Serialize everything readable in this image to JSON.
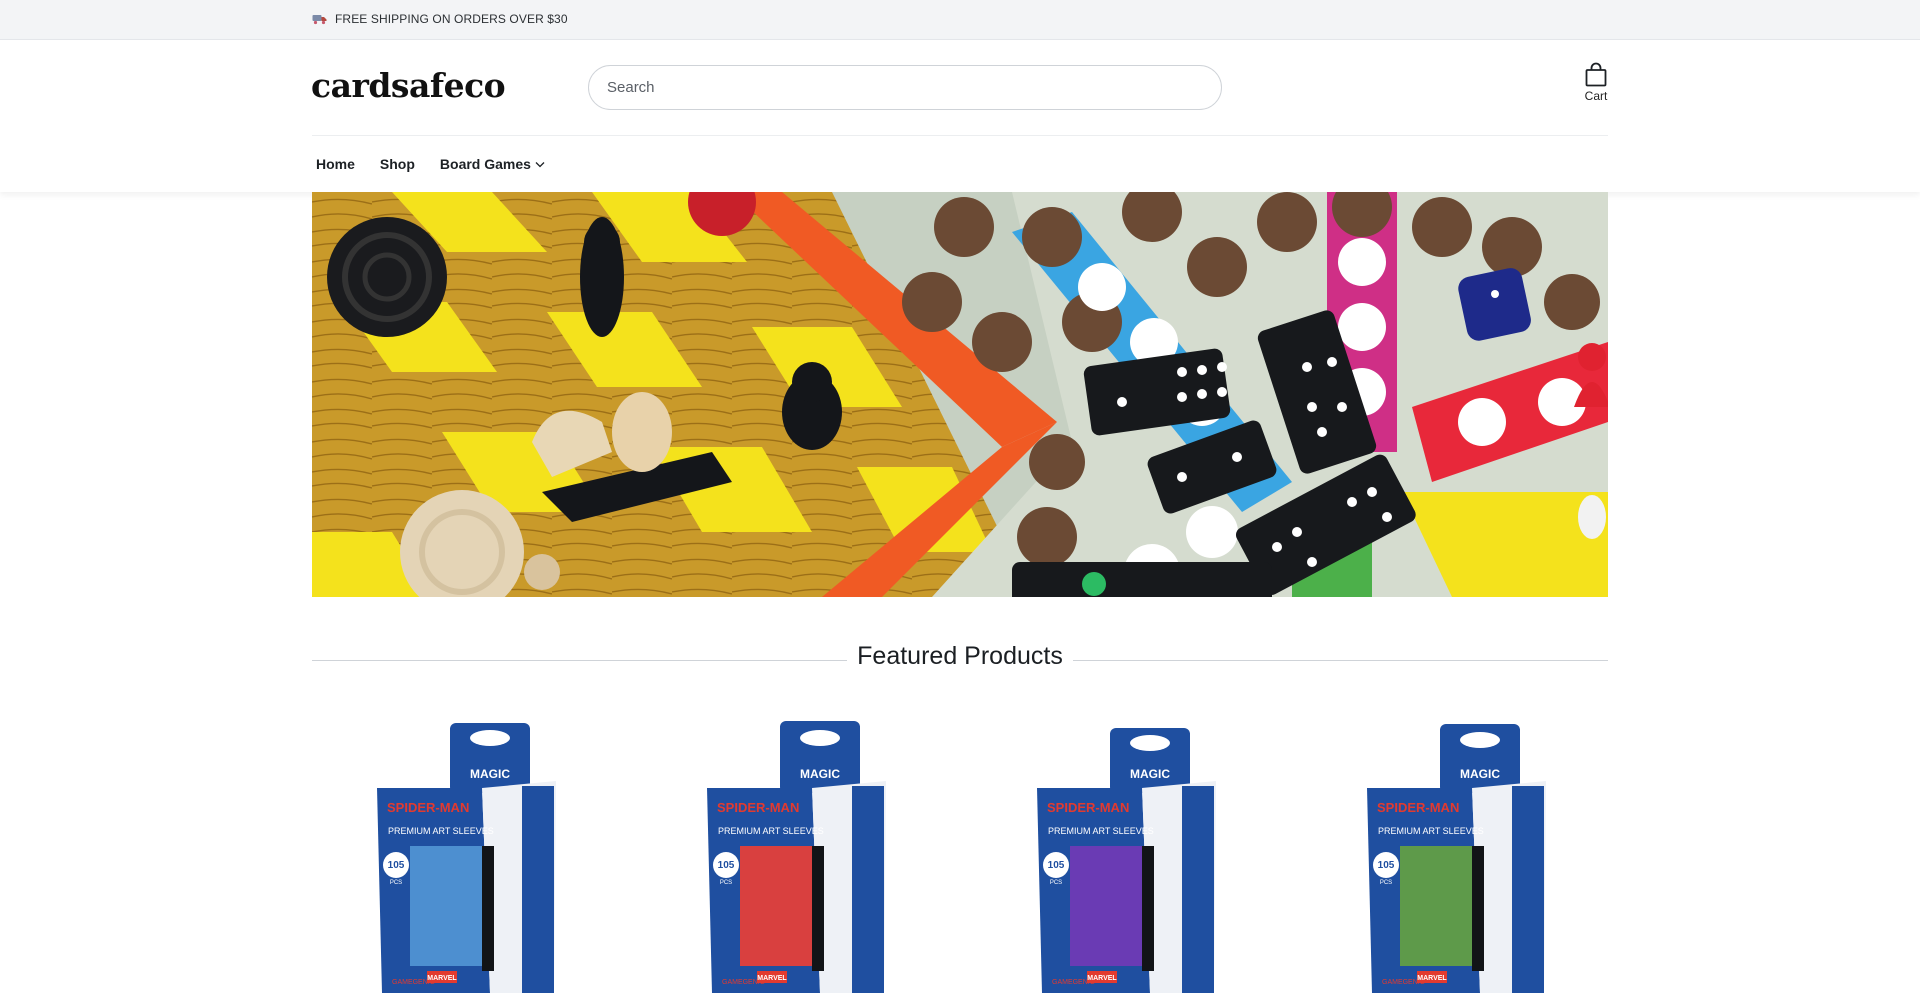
{
  "announcement": {
    "icon": "truck-icon",
    "text": "FREE SHIPPING ON ORDERS OVER $30"
  },
  "header": {
    "logo": "cardsafeco",
    "search_placeholder": "Search",
    "cart_label": "Cart",
    "cart_icon": "shopping-bag-icon"
  },
  "nav": {
    "items": [
      {
        "label": "Home"
      },
      {
        "label": "Shop"
      },
      {
        "label": "Board Games",
        "icon": "chevron-down-icon"
      }
    ]
  },
  "hero": {
    "description": "board-games-banner"
  },
  "featured": {
    "title": "Featured Products",
    "products": [
      {
        "brand": "SPIDER-MAN",
        "sub_brand": "MAGIC",
        "line": "PREMIUM ART SLEEVES",
        "count": "105",
        "count_unit": "PCS",
        "maker": "GAMEGENIC",
        "label": "MARVEL",
        "accent": "#4d8fd0"
      },
      {
        "brand": "SPIDER-MAN",
        "sub_brand": "MAGIC",
        "line": "PREMIUM ART SLEEVES",
        "count": "105",
        "count_unit": "PCS",
        "maker": "GAMEGENIC",
        "label": "MARVEL",
        "accent": "#d9403f"
      },
      {
        "brand": "SPIDER-MAN",
        "sub_brand": "MAGIC",
        "line": "PREMIUM ART SLEEVES",
        "count": "105",
        "count_unit": "PCS",
        "maker": "GAMEGENIC",
        "label": "MARVEL",
        "accent": "#6a3bb4"
      },
      {
        "brand": "SPIDER-MAN",
        "sub_brand": "MAGIC",
        "line": "PREMIUM ART SLEEVES",
        "count": "105",
        "count_unit": "PCS",
        "maker": "GAMEGENIC",
        "label": "MARVEL",
        "accent": "#5e9a4a"
      }
    ]
  },
  "colors": {
    "announcement_bg": "#f3f4f6",
    "text": "#1f2328",
    "box_blue": "#1f4fa0"
  }
}
